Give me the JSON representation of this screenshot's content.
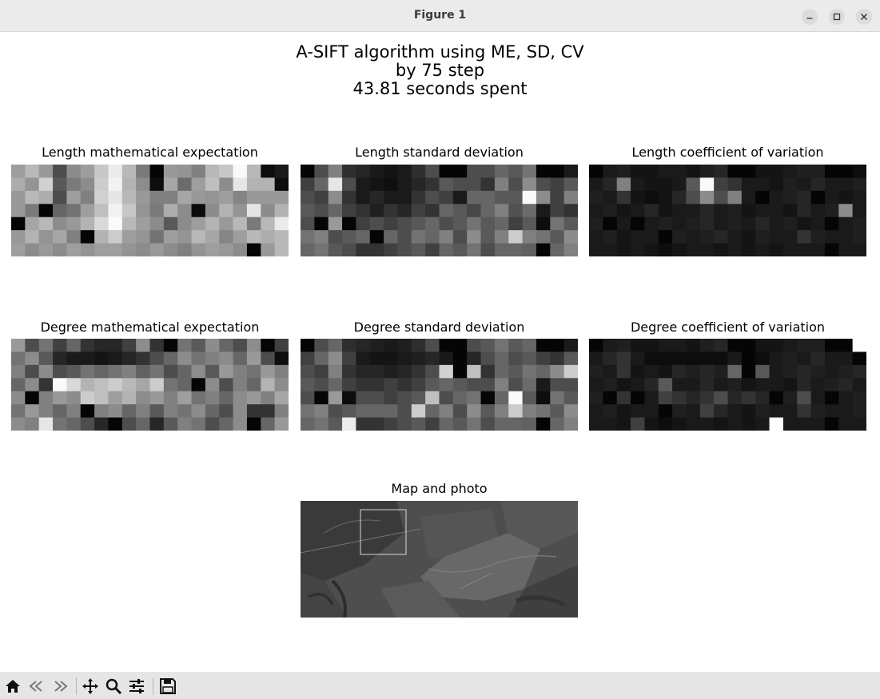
{
  "window": {
    "title": "Figure 1"
  },
  "figure": {
    "suptitle_lines": [
      "A-SIFT algorithm using ME, SD, CV",
      "by 75 step",
      "43.81 seconds spent"
    ],
    "panels": [
      {
        "title": "Length mathematical expectation"
      },
      {
        "title": "Length standard deviation"
      },
      {
        "title": "Length coefficient of variation"
      },
      {
        "title": "Degree mathematical expectation"
      },
      {
        "title": "Degree standard deviation"
      },
      {
        "title": "Degree coefficient of variation"
      },
      {
        "title": "Map and photo"
      }
    ]
  },
  "chart_data": [
    {
      "type": "heatmap",
      "title": "Length mathematical expectation",
      "colormap": "gray",
      "rows": [
        [
          0.62,
          0.72,
          0.6,
          0.3,
          0.55,
          0.62,
          0.78,
          0.92,
          0.72,
          0.48,
          0.02,
          0.6,
          0.58,
          0.5,
          0.72,
          0.78,
          0.98,
          0.72,
          0.05,
          0.1
        ],
        [
          0.68,
          0.58,
          0.82,
          0.35,
          0.48,
          0.55,
          0.8,
          0.95,
          0.7,
          0.55,
          0.05,
          0.65,
          0.42,
          0.62,
          0.75,
          0.55,
          0.9,
          0.7,
          0.7,
          0.05
        ],
        [
          0.6,
          0.72,
          0.68,
          0.3,
          0.62,
          0.5,
          0.82,
          0.9,
          0.72,
          0.6,
          0.5,
          0.5,
          0.65,
          0.6,
          0.58,
          0.62,
          0.52,
          0.6,
          0.6,
          0.6
        ],
        [
          0.6,
          0.48,
          0.02,
          0.4,
          0.45,
          0.62,
          0.75,
          0.95,
          0.78,
          0.58,
          0.48,
          0.68,
          0.55,
          0.05,
          0.55,
          0.7,
          0.58,
          0.9,
          0.55,
          0.7
        ],
        [
          0.02,
          0.65,
          0.72,
          0.55,
          0.6,
          0.7,
          0.85,
          0.98,
          0.72,
          0.62,
          0.55,
          0.35,
          0.55,
          0.62,
          0.7,
          0.6,
          0.72,
          0.48,
          0.72,
          0.92
        ],
        [
          0.6,
          0.7,
          0.58,
          0.65,
          0.5,
          0.02,
          0.7,
          0.8,
          0.62,
          0.58,
          0.45,
          0.62,
          0.58,
          0.72,
          0.65,
          0.52,
          0.62,
          0.72,
          0.68,
          0.72
        ],
        [
          0.62,
          0.55,
          0.6,
          0.55,
          0.62,
          0.58,
          0.62,
          0.62,
          0.58,
          0.55,
          0.6,
          0.55,
          0.5,
          0.58,
          0.62,
          0.6,
          0.55,
          0.02,
          0.6,
          0.72
        ]
      ]
    },
    {
      "type": "heatmap",
      "title": "Length standard deviation",
      "colormap": "gray",
      "rows": [
        [
          0.02,
          0.3,
          0.5,
          0.18,
          0.15,
          0.1,
          0.08,
          0.1,
          0.18,
          0.3,
          0.02,
          0.02,
          0.3,
          0.3,
          0.4,
          0.35,
          0.45,
          0.02,
          0.02,
          0.1
        ],
        [
          0.25,
          0.4,
          0.9,
          0.3,
          0.1,
          0.08,
          0.06,
          0.1,
          0.15,
          0.2,
          0.35,
          0.3,
          0.3,
          0.2,
          0.5,
          0.3,
          0.55,
          0.3,
          0.25,
          0.35
        ],
        [
          0.3,
          0.25,
          0.55,
          0.2,
          0.1,
          0.15,
          0.1,
          0.1,
          0.2,
          0.3,
          0.25,
          0.1,
          0.4,
          0.4,
          0.35,
          0.35,
          0.98,
          0.55,
          0.25,
          0.5
        ],
        [
          0.35,
          0.3,
          0.4,
          0.25,
          0.2,
          0.12,
          0.2,
          0.15,
          0.25,
          0.2,
          0.4,
          0.35,
          0.28,
          0.4,
          0.5,
          0.32,
          0.42,
          0.1,
          0.25,
          0.2
        ],
        [
          0.3,
          0.02,
          0.6,
          0.02,
          0.25,
          0.3,
          0.25,
          0.3,
          0.35,
          0.4,
          0.3,
          0.35,
          0.45,
          0.35,
          0.4,
          0.25,
          0.35,
          0.05,
          0.45,
          0.35
        ],
        [
          0.45,
          0.5,
          0.3,
          0.35,
          0.4,
          0.02,
          0.4,
          0.3,
          0.45,
          0.4,
          0.5,
          0.3,
          0.55,
          0.35,
          0.5,
          0.8,
          0.5,
          0.45,
          0.35,
          0.55
        ],
        [
          0.4,
          0.45,
          0.35,
          0.3,
          0.2,
          0.2,
          0.25,
          0.3,
          0.35,
          0.25,
          0.4,
          0.35,
          0.45,
          0.3,
          0.4,
          0.4,
          0.38,
          0.02,
          0.4,
          0.5
        ]
      ]
    },
    {
      "type": "heatmap",
      "title": "Length coefficient of variation",
      "colormap": "gray",
      "rows": [
        [
          0.02,
          0.1,
          0.12,
          0.08,
          0.08,
          0.1,
          0.1,
          0.08,
          0.12,
          0.15,
          0.02,
          0.02,
          0.08,
          0.08,
          0.1,
          0.12,
          0.12,
          0.02,
          0.02,
          0.05
        ],
        [
          0.1,
          0.15,
          0.5,
          0.1,
          0.08,
          0.08,
          0.1,
          0.35,
          0.98,
          0.25,
          0.2,
          0.1,
          0.1,
          0.08,
          0.12,
          0.1,
          0.15,
          0.1,
          0.1,
          0.12
        ],
        [
          0.12,
          0.1,
          0.2,
          0.08,
          0.05,
          0.08,
          0.15,
          0.3,
          0.55,
          0.3,
          0.5,
          0.1,
          0.02,
          0.1,
          0.12,
          0.15,
          0.02,
          0.1,
          0.08,
          0.1
        ],
        [
          0.1,
          0.12,
          0.08,
          0.1,
          0.15,
          0.08,
          0.1,
          0.1,
          0.15,
          0.1,
          0.12,
          0.08,
          0.1,
          0.1,
          0.08,
          0.15,
          0.1,
          0.12,
          0.55,
          0.1
        ],
        [
          0.12,
          0.02,
          0.1,
          0.02,
          0.1,
          0.12,
          0.1,
          0.12,
          0.15,
          0.1,
          0.12,
          0.1,
          0.15,
          0.1,
          0.12,
          0.08,
          0.1,
          0.02,
          0.1,
          0.12
        ],
        [
          0.1,
          0.12,
          0.08,
          0.1,
          0.1,
          0.02,
          0.12,
          0.1,
          0.12,
          0.15,
          0.1,
          0.08,
          0.12,
          0.1,
          0.1,
          0.2,
          0.12,
          0.1,
          0.1,
          0.12
        ],
        [
          0.1,
          0.1,
          0.08,
          0.1,
          0.08,
          0.05,
          0.08,
          0.1,
          0.1,
          0.08,
          0.1,
          0.08,
          0.1,
          0.08,
          0.1,
          0.1,
          0.1,
          0.02,
          0.1,
          0.1
        ]
      ]
    },
    {
      "type": "heatmap",
      "title": "Degree mathematical expectation",
      "colormap": "gray",
      "rows": [
        [
          0.6,
          0.3,
          0.45,
          0.25,
          0.4,
          0.2,
          0.15,
          0.15,
          0.25,
          0.55,
          0.2,
          0.02,
          0.45,
          0.35,
          0.55,
          0.4,
          0.3,
          0.55,
          0.02,
          0.25
        ],
        [
          0.45,
          0.55,
          0.35,
          0.15,
          0.1,
          0.1,
          0.08,
          0.1,
          0.15,
          0.2,
          0.3,
          0.4,
          0.55,
          0.45,
          0.5,
          0.55,
          0.4,
          0.6,
          0.3,
          0.05
        ],
        [
          0.5,
          0.3,
          0.55,
          0.3,
          0.35,
          0.45,
          0.4,
          0.45,
          0.5,
          0.38,
          0.45,
          0.3,
          0.4,
          0.55,
          0.35,
          0.6,
          0.5,
          0.45,
          0.6,
          0.5
        ],
        [
          0.4,
          0.55,
          0.2,
          0.98,
          0.85,
          0.7,
          0.75,
          0.8,
          0.72,
          0.65,
          0.8,
          0.45,
          0.4,
          0.02,
          0.55,
          0.3,
          0.5,
          0.4,
          0.7,
          0.55
        ],
        [
          0.55,
          0.02,
          0.5,
          0.6,
          0.55,
          0.8,
          0.75,
          0.62,
          0.7,
          0.55,
          0.6,
          0.5,
          0.62,
          0.45,
          0.5,
          0.4,
          0.55,
          0.6,
          0.5,
          0.65
        ],
        [
          0.45,
          0.6,
          0.5,
          0.4,
          0.5,
          0.02,
          0.5,
          0.55,
          0.4,
          0.5,
          0.35,
          0.5,
          0.45,
          0.55,
          0.4,
          0.3,
          0.55,
          0.2,
          0.2,
          0.5
        ],
        [
          0.55,
          0.5,
          0.9,
          0.45,
          0.4,
          0.3,
          0.15,
          0.02,
          0.3,
          0.4,
          0.15,
          0.35,
          0.5,
          0.45,
          0.3,
          0.4,
          0.55,
          0.02,
          0.4,
          0.6
        ]
      ]
    },
    {
      "type": "heatmap",
      "title": "Degree standard deviation",
      "colormap": "gray",
      "rows": [
        [
          0.02,
          0.3,
          0.4,
          0.18,
          0.15,
          0.12,
          0.1,
          0.12,
          0.18,
          0.3,
          0.02,
          0.02,
          0.3,
          0.35,
          0.45,
          0.35,
          0.4,
          0.02,
          0.02,
          0.1
        ],
        [
          0.25,
          0.4,
          0.55,
          0.25,
          0.1,
          0.08,
          0.08,
          0.1,
          0.12,
          0.15,
          0.1,
          0.02,
          0.15,
          0.3,
          0.4,
          0.3,
          0.35,
          0.25,
          0.2,
          0.35
        ],
        [
          0.3,
          0.25,
          0.5,
          0.2,
          0.15,
          0.15,
          0.12,
          0.15,
          0.2,
          0.3,
          0.82,
          0.02,
          0.75,
          0.2,
          0.4,
          0.35,
          0.45,
          0.4,
          0.55,
          0.8
        ],
        [
          0.35,
          0.3,
          0.4,
          0.25,
          0.2,
          0.2,
          0.25,
          0.2,
          0.25,
          0.35,
          0.4,
          0.35,
          0.3,
          0.3,
          0.5,
          0.3,
          0.42,
          0.1,
          0.3,
          0.3
        ],
        [
          0.3,
          0.02,
          0.6,
          0.05,
          0.3,
          0.3,
          0.25,
          0.3,
          0.35,
          0.75,
          0.3,
          0.4,
          0.45,
          0.02,
          0.4,
          0.98,
          0.35,
          0.05,
          0.45,
          0.35
        ],
        [
          0.45,
          0.5,
          0.3,
          0.35,
          0.4,
          0.4,
          0.4,
          0.3,
          0.8,
          0.4,
          0.5,
          0.3,
          0.55,
          0.35,
          0.5,
          0.8,
          0.5,
          0.45,
          0.35,
          0.55
        ],
        [
          0.4,
          0.45,
          0.35,
          0.92,
          0.2,
          0.2,
          0.25,
          0.3,
          0.35,
          0.25,
          0.4,
          0.35,
          0.45,
          0.3,
          0.4,
          0.4,
          0.38,
          0.02,
          0.4,
          0.5
        ]
      ]
    },
    {
      "type": "heatmap",
      "title": "Degree coefficient of variation",
      "colormap": "gray",
      "rows": [
        [
          0.02,
          0.1,
          0.12,
          0.08,
          0.08,
          0.1,
          0.1,
          0.08,
          0.12,
          0.15,
          0.02,
          0.02,
          0.08,
          0.08,
          0.1,
          0.12,
          0.12,
          0.02,
          0.02,
          1.0
        ],
        [
          0.1,
          0.15,
          0.2,
          0.1,
          0.05,
          0.05,
          0.05,
          0.05,
          0.05,
          0.05,
          0.1,
          0.02,
          0.05,
          0.1,
          0.12,
          0.1,
          0.15,
          0.1,
          0.1,
          0.02
        ],
        [
          0.12,
          0.1,
          0.2,
          0.08,
          0.1,
          0.08,
          0.15,
          0.12,
          0.15,
          0.12,
          0.4,
          0.02,
          0.35,
          0.1,
          0.12,
          0.15,
          0.12,
          0.1,
          0.12,
          0.15
        ],
        [
          0.1,
          0.12,
          0.08,
          0.1,
          0.15,
          0.35,
          0.1,
          0.1,
          0.15,
          0.1,
          0.12,
          0.08,
          0.1,
          0.1,
          0.08,
          0.15,
          0.1,
          0.12,
          0.15,
          0.1
        ],
        [
          0.12,
          0.02,
          0.2,
          0.02,
          0.1,
          0.25,
          0.2,
          0.15,
          0.2,
          0.3,
          0.15,
          0.2,
          0.15,
          0.02,
          0.12,
          0.3,
          0.1,
          0.02,
          0.1,
          0.12
        ],
        [
          0.1,
          0.12,
          0.08,
          0.1,
          0.1,
          0.02,
          0.12,
          0.1,
          0.25,
          0.15,
          0.1,
          0.08,
          0.12,
          0.1,
          0.1,
          0.2,
          0.12,
          0.1,
          0.1,
          0.12
        ],
        [
          0.1,
          0.1,
          0.08,
          0.25,
          0.08,
          0.05,
          0.08,
          0.1,
          0.1,
          0.08,
          0.1,
          0.08,
          0.1,
          1.0,
          0.1,
          0.1,
          0.1,
          0.02,
          0.1,
          0.1
        ]
      ]
    }
  ],
  "toolbar": {
    "items": [
      {
        "icon": "home-icon"
      },
      {
        "icon": "back-icon"
      },
      {
        "icon": "forward-icon"
      },
      {
        "icon": "pan-icon"
      },
      {
        "icon": "zoom-icon"
      },
      {
        "icon": "configure-subplots-icon"
      },
      {
        "icon": "save-icon"
      }
    ]
  }
}
